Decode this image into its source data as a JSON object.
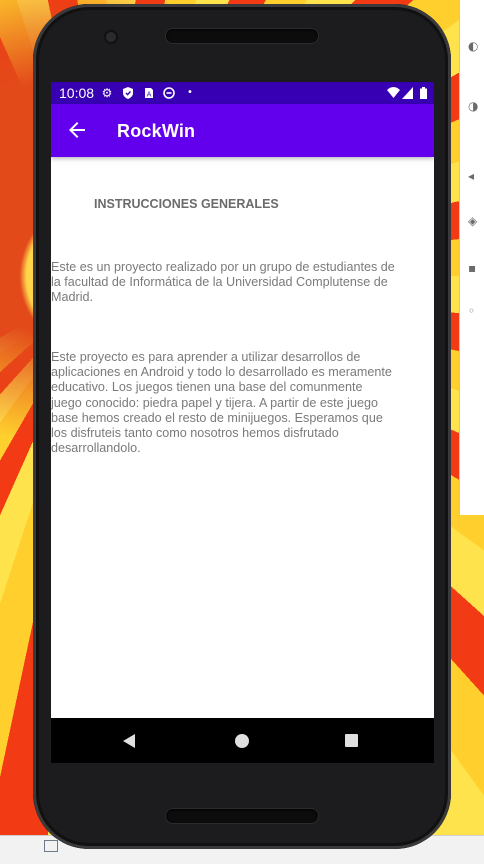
{
  "status_bar": {
    "time": "10:08",
    "left_icons": [
      "gear-icon",
      "shield-icon",
      "sim-card-icon",
      "sync-icon",
      "dot-icon"
    ],
    "right_icons": [
      "wifi-icon",
      "signal-icon",
      "battery-icon"
    ]
  },
  "app_bar": {
    "title": "RockWin",
    "back_icon": "arrow-back-icon"
  },
  "content": {
    "heading": "INSTRUCCIONES GENERALES",
    "paragraph_1": "Este es un proyecto realizado por un grupo de estudiantes de la facultad de Informática de la Universidad Complutense de Madrid.",
    "paragraph_2": "Este proyecto es para aprender a utilizar desarrollos de aplicaciones en Android y todo lo desarrollado es meramente educativo. Los juegos tienen una base del comunmente juego conocido: piedra papel y tijera. A partir de este juego base hemos creado el resto de minijuegos. Esperamos que los disfruteis tanto como nosotros hemos disfrutado desarrollandolo."
  },
  "navigation_bar": {
    "icons": [
      "nav-back-icon",
      "nav-home-icon",
      "nav-recents-icon"
    ]
  },
  "colors": {
    "status_bar": "#3700b3",
    "app_bar": "#6200ee",
    "body_text": "#757575",
    "nav_bar": "#000000"
  }
}
